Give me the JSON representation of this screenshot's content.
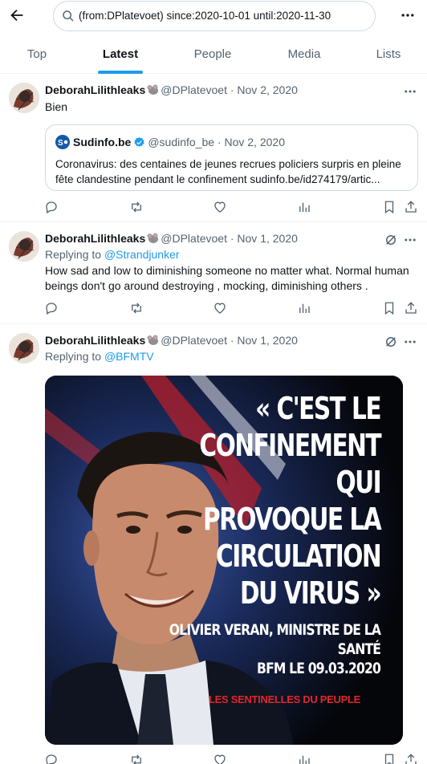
{
  "search": {
    "query": "(from:DPlatevoet) since:2020-10-01 until:2020-11-30"
  },
  "tabs": [
    {
      "label": "Top"
    },
    {
      "label": "Latest"
    },
    {
      "label": "People"
    },
    {
      "label": "Media"
    },
    {
      "label": "Lists"
    }
  ],
  "active_tab": "Latest",
  "tweets": [
    {
      "name": "DeborahLilithleaks",
      "handle_date": "@DPlatevoet · Nov 2, 2020",
      "text": "Bien",
      "quote": {
        "name": "Sudinfo.be",
        "handle_date": "@sudinfo_be · Nov 2, 2020",
        "text": "Coronavirus: des centaines de jeunes recrues policiers surpris en pleine fête clandestine pendant le confinement sudinfo.be/id274179/artic..."
      }
    },
    {
      "name": "DeborahLilithleaks",
      "handle_date": "@DPlatevoet · Nov 1, 2020",
      "reply_prefix": "Replying to",
      "reply_handle": "@Strandjunker",
      "text": "How sad and low to diminishing someone no matter what. Normal human beings don't go around destroying , mocking, diminishing others ."
    },
    {
      "name": "DeborahLilithleaks",
      "handle_date": "@DPlatevoet · Nov 1, 2020",
      "reply_prefix": "Replying to",
      "reply_handle": "@BFMTV",
      "image": {
        "lines_big": [
          "« C'EST LE",
          "CONFINEMENT",
          "QUI",
          "PROVOQUE LA",
          "CIRCULATION",
          "DU VIRUS »"
        ],
        "lines_small": [
          "OLIVIER VERAN, MINISTRE DE LA",
          "SANTÉ",
          "BFM LE 09.03.2020"
        ],
        "brand": "LES SENTINELLES DU PEUPLE"
      }
    }
  ],
  "colors": {
    "accent": "#1d9bf0",
    "muted": "#536471",
    "border": "#eff3f4"
  }
}
